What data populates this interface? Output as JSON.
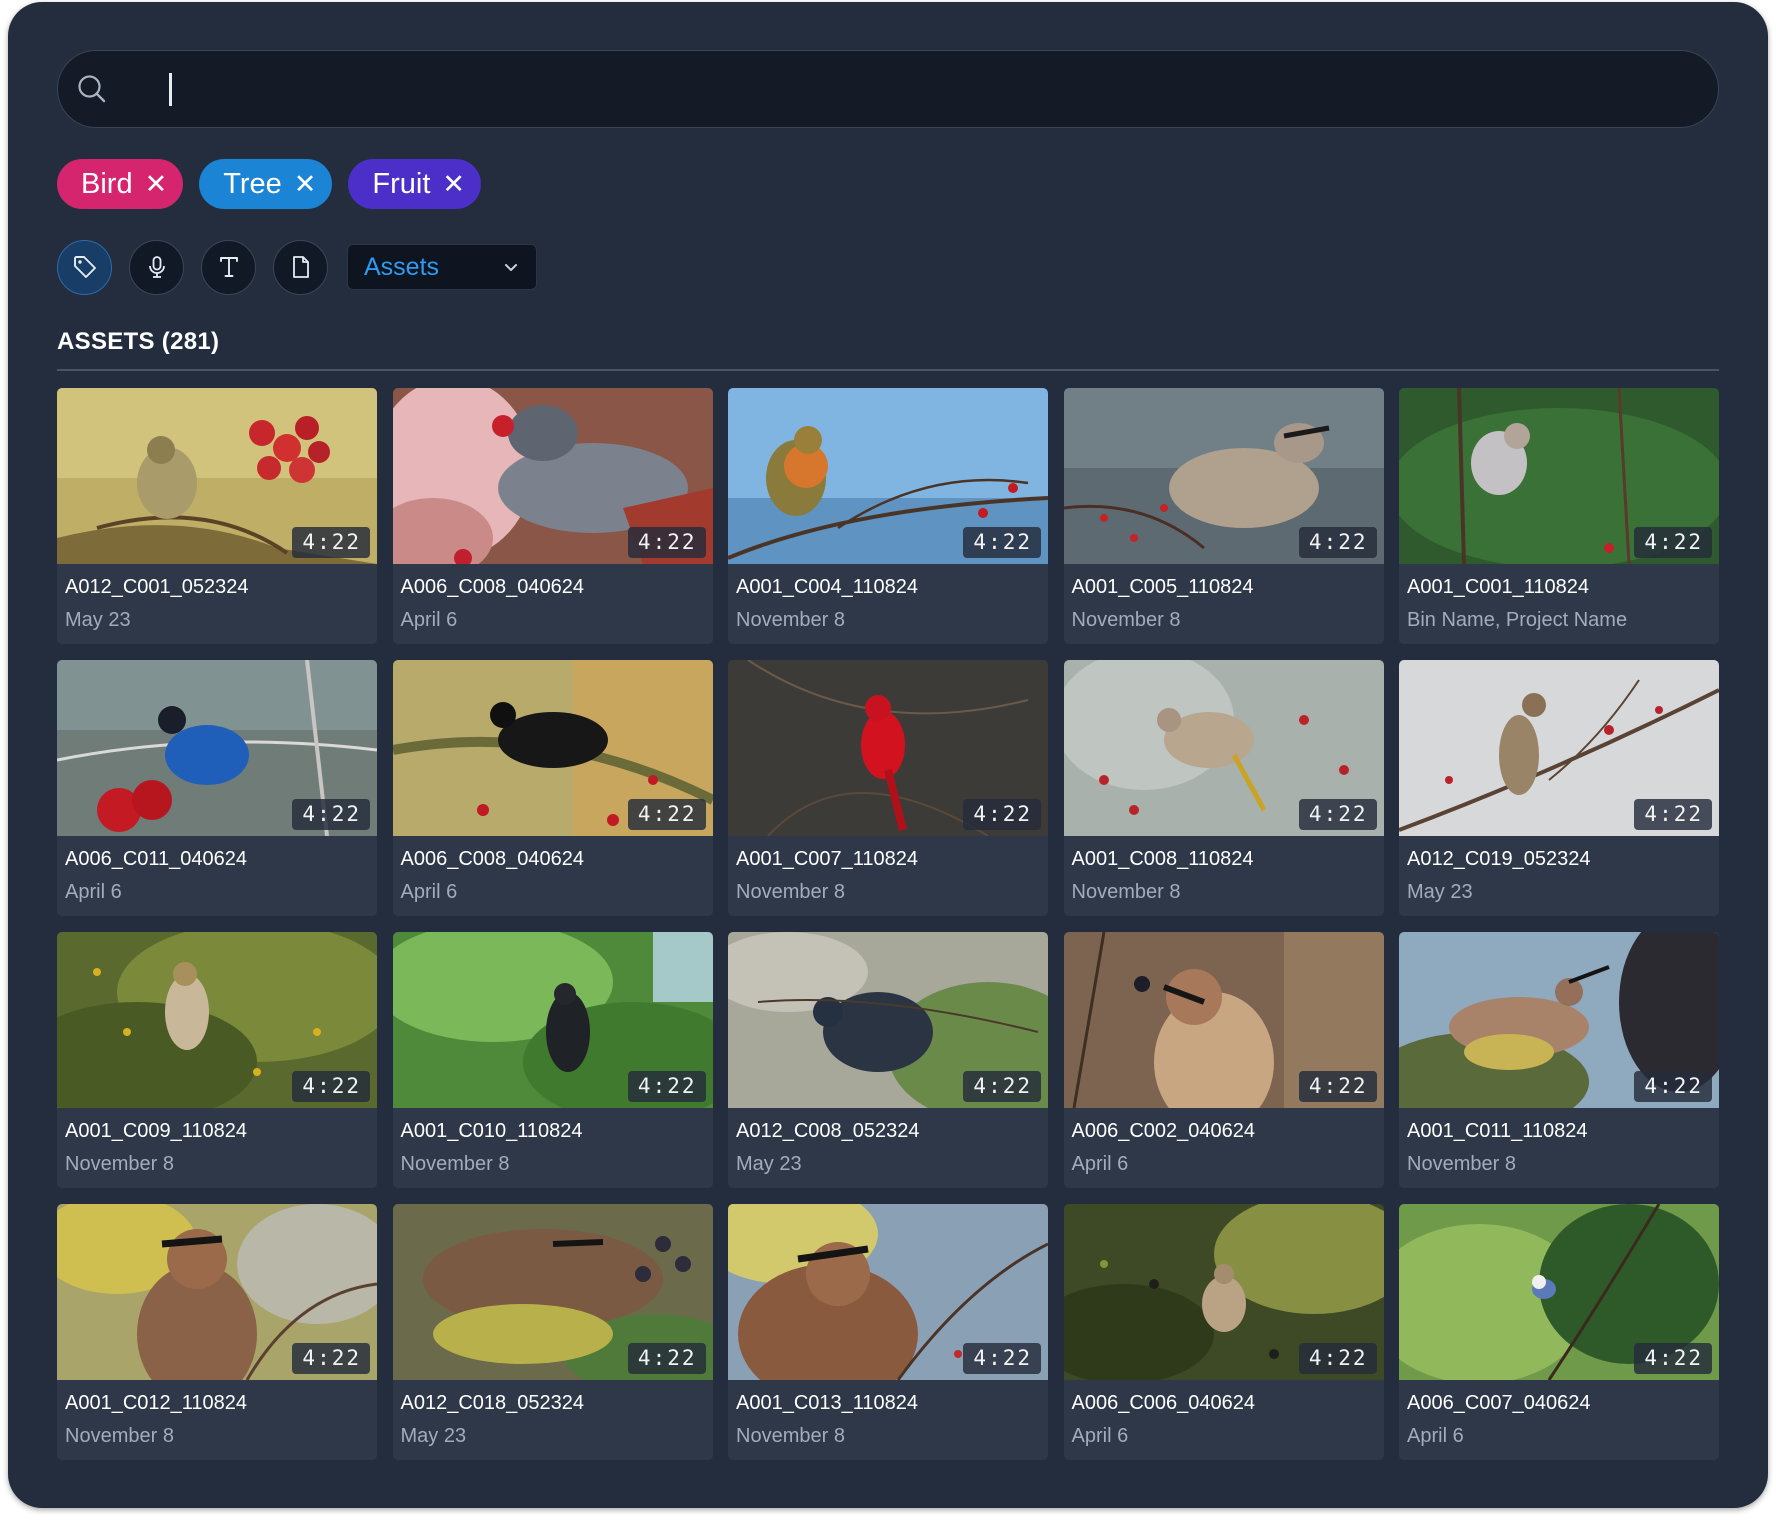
{
  "search": {
    "value": "",
    "placeholder": ""
  },
  "filters": [
    {
      "label": "Bird",
      "color": "#d5256f"
    },
    {
      "label": "Tree",
      "color": "#1b84d4"
    },
    {
      "label": "Fruit",
      "color": "#4b2fc8"
    }
  ],
  "remove_glyph": "✕",
  "toolbar": {
    "buttons": [
      "tag-icon",
      "microphone-icon",
      "text-icon",
      "document-icon"
    ],
    "active_button": "tag-icon",
    "scope_select": {
      "value": "Assets"
    }
  },
  "section": {
    "title": "ASSETS (281)"
  },
  "colors": {
    "accent": "#2e9bf0",
    "panel": "#232d3e",
    "card": "#2e3849"
  },
  "assets": [
    {
      "name": "A012_C001_052324",
      "subtitle": "May 23",
      "duration": "4:22"
    },
    {
      "name": "A006_C008_040624",
      "subtitle": "April 6",
      "duration": "4:22"
    },
    {
      "name": "A001_C004_110824",
      "subtitle": "November 8",
      "duration": "4:22"
    },
    {
      "name": "A001_C005_110824",
      "subtitle": "November 8",
      "duration": "4:22"
    },
    {
      "name": "A001_C001_110824",
      "subtitle": "Bin Name, Project Name",
      "duration": "4:22"
    },
    {
      "name": "A006_C011_040624",
      "subtitle": "April 6",
      "duration": "4:22"
    },
    {
      "name": "A006_C008_040624",
      "subtitle": "April 6",
      "duration": "4:22"
    },
    {
      "name": "A001_C007_110824",
      "subtitle": "November 8",
      "duration": "4:22"
    },
    {
      "name": "A001_C008_110824",
      "subtitle": "November 8",
      "duration": "4:22"
    },
    {
      "name": "A012_C019_052324",
      "subtitle": "May 23",
      "duration": "4:22"
    },
    {
      "name": "A001_C009_110824",
      "subtitle": "November 8",
      "duration": "4:22"
    },
    {
      "name": "A001_C010_110824",
      "subtitle": "November 8",
      "duration": "4:22"
    },
    {
      "name": "A012_C008_052324",
      "subtitle": "May 23",
      "duration": "4:22"
    },
    {
      "name": "A006_C002_040624",
      "subtitle": "April 6",
      "duration": "4:22"
    },
    {
      "name": "A001_C011_110824",
      "subtitle": "November 8",
      "duration": "4:22"
    },
    {
      "name": "A001_C012_110824",
      "subtitle": "November 8",
      "duration": "4:22"
    },
    {
      "name": "A012_C018_052324",
      "subtitle": "May 23",
      "duration": "4:22"
    },
    {
      "name": "A001_C013_110824",
      "subtitle": "November 8",
      "duration": "4:22"
    },
    {
      "name": "A006_C006_040624",
      "subtitle": "April 6",
      "duration": "4:22"
    },
    {
      "name": "A006_C007_040624",
      "subtitle": "April 6",
      "duration": "4:22"
    }
  ]
}
